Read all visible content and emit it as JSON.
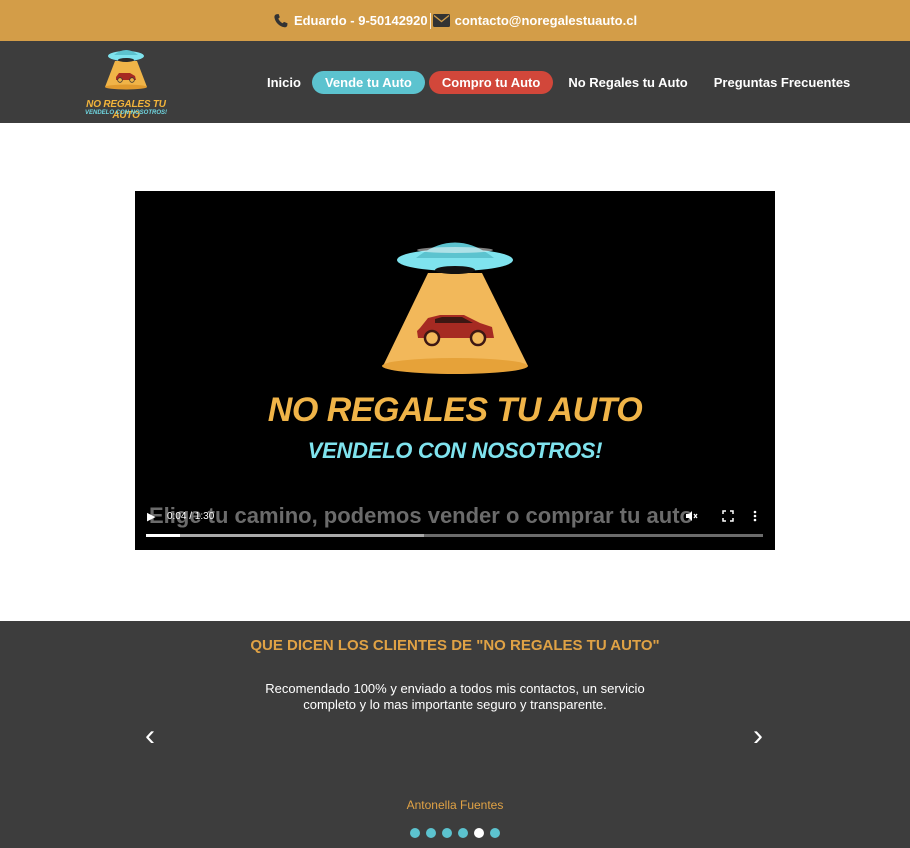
{
  "topbar": {
    "phone_icon": "phone-icon",
    "phone_text": "Eduardo - 9-50142920",
    "mail_icon": "envelope-icon",
    "email_text": "contacto@noregalestuauto.cl",
    "bg_color": "#d39d48"
  },
  "logo": {
    "line1": "NO REGALES TU AUTO",
    "line2": "VENDELO CON NOSOTROS!"
  },
  "nav": {
    "items": [
      {
        "label": "Inicio"
      },
      {
        "label": "Vende tu Auto",
        "color": "#5cc3cf"
      },
      {
        "label": "Compro tu Auto",
        "color": "#d2473a"
      },
      {
        "label": "No Regales tu Auto"
      },
      {
        "label": "Preguntas Frecuentes"
      }
    ]
  },
  "video": {
    "title": "NO REGALES TU AUTO",
    "subtitle": "VENDELO CON NOSOTROS!",
    "caption": "Elige tu camino, podemos vender o comprar tu auto",
    "time": "0:04 / 1:30",
    "progress_played": 0.055,
    "progress_buffered": 0.45,
    "icons": {
      "play": "play-icon",
      "mute": "volume-muted-icon",
      "fullscreen": "fullscreen-icon",
      "more": "more-options-icon"
    }
  },
  "testimonials": {
    "heading": "QUE DICEN LOS CLIENTES DE \"NO REGALES TU AUTO\"",
    "quote": "Recomendado 100% y enviado a todos mis contactos, un servicio completo y lo mas importante seguro y transparente.",
    "author": "Antonella Fuentes",
    "prev": "‹",
    "next": "›",
    "dots_total": 6,
    "dots_active_index": 4
  },
  "colors": {
    "nav_bg": "#3d3d3d",
    "accent_orange": "#e0a245",
    "accent_teal": "#5cc3cf",
    "accent_red": "#d2473a"
  }
}
